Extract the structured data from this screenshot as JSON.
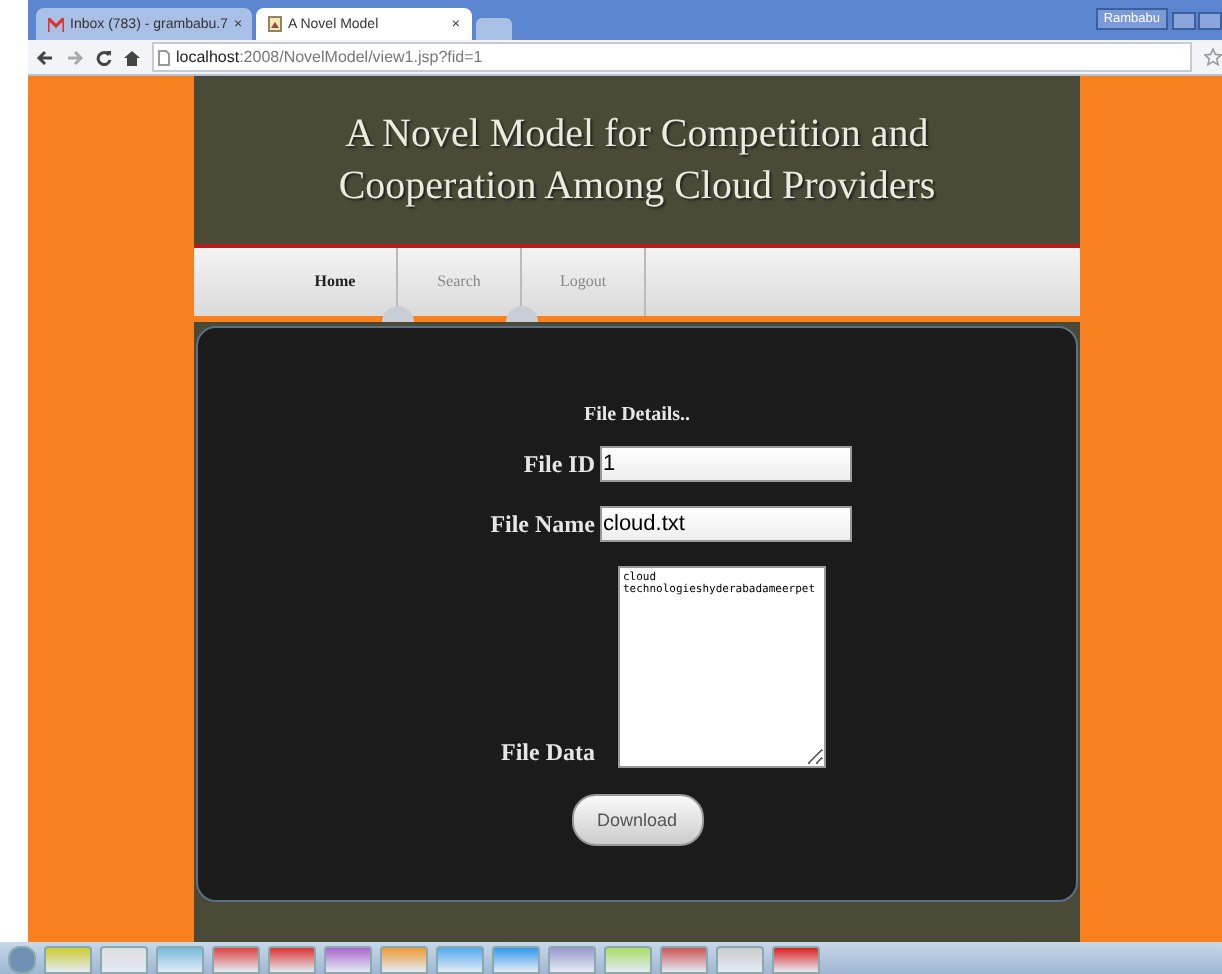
{
  "browser": {
    "tabs": [
      {
        "label": "Inbox (783) - grambabu.7",
        "close": "×",
        "selected": false
      },
      {
        "label": "A Novel Model",
        "close": "×",
        "selected": true
      }
    ],
    "user": "Rambabu",
    "url_host": "localhost",
    "url_rest": ":2008/NovelModel/view1.jsp?fid=1"
  },
  "site": {
    "title": "A Novel Model for Competition and Cooperation Among Cloud Providers",
    "nav": [
      {
        "label": "Home",
        "selected": true
      },
      {
        "label": "Search",
        "selected": false
      },
      {
        "label": "Logout",
        "selected": false
      }
    ],
    "form": {
      "heading": "File Details..",
      "fields": [
        {
          "kind": "input",
          "label": "File ID",
          "value": "1"
        },
        {
          "kind": "input",
          "label": "File Name",
          "value": "cloud.txt"
        },
        {
          "kind": "textarea",
          "label": "File Data",
          "value": "cloud\ntechnologieshyderabadameerpet"
        }
      ],
      "button": "Download"
    }
  }
}
